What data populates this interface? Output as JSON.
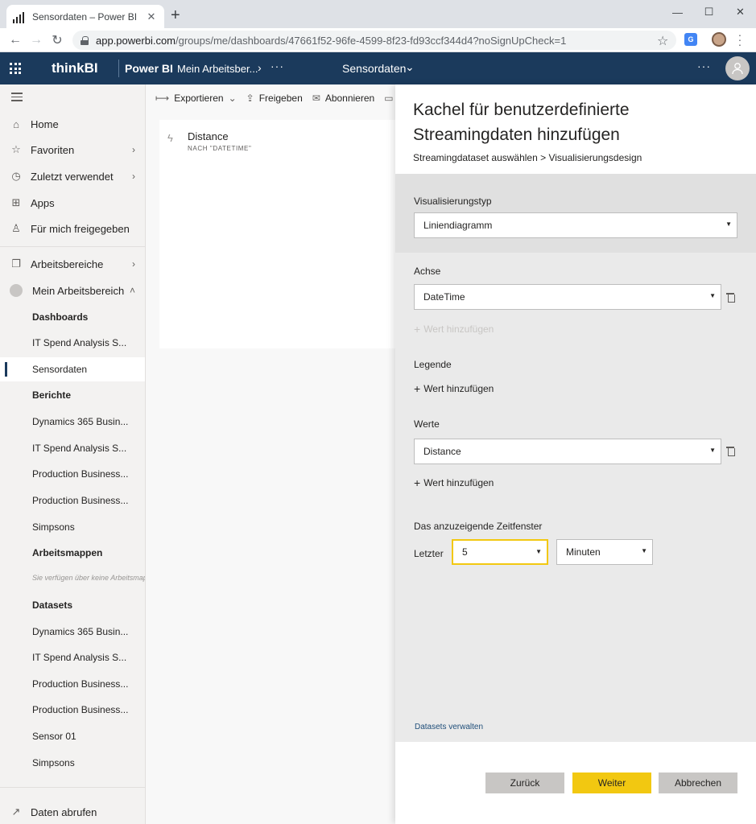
{
  "browser": {
    "tab_title": "Sensordaten – Power BI",
    "tab_close": "✕",
    "new_tab": "+",
    "url_host": "app.powerbi.com",
    "url_path": "/groups/me/dashboards/47661f52-96fe-4599-8f23-fd93ccf344d4?noSignUpCheck=1",
    "window_controls": [
      "—",
      "☐",
      "✕"
    ],
    "ext_label": "G"
  },
  "header": {
    "brand": "thinkBI",
    "product": "Power BI",
    "workspace": "Mein Arbeitsber...",
    "dashboard": "Sensordaten",
    "header_bg": "#1b3a5c"
  },
  "nav": {
    "items": [
      {
        "label": "Home",
        "icon": "home-icon"
      },
      {
        "label": "Favoriten",
        "icon": "star-icon"
      },
      {
        "label": "Zuletzt verwendet",
        "icon": "clock-icon"
      },
      {
        "label": "Apps",
        "icon": "apps-icon"
      },
      {
        "label": "Für mich freigegeben",
        "icon": "shared-icon"
      }
    ],
    "workspaces": "Arbeitsbereiche",
    "my_workspace": "Mein Arbeitsbereich",
    "sections": {
      "dashboards": "Dashboards",
      "dashboards_items": [
        "IT Spend Analysis S...",
        "Sensordaten"
      ],
      "reports": "Berichte",
      "reports_items": [
        "Dynamics 365 Busin...",
        "IT Spend Analysis S...",
        "Production Business...",
        "Production Business...",
        "Simpsons"
      ],
      "workbooks": "Arbeitsmappen",
      "workbooks_empty": "Sie verfügen über keine Arbeitsmappen",
      "datasets": "Datasets",
      "datasets_items": [
        "Dynamics 365 Busin...",
        "IT Spend Analysis S...",
        "Production Business...",
        "Production Business...",
        "Sensor 01",
        "Simpsons"
      ]
    },
    "get_data": "Daten abrufen"
  },
  "toolbar": {
    "export": "Exportieren",
    "share": "Freigeben",
    "subscribe": "Abonnieren"
  },
  "tile": {
    "title": "Distance",
    "subtitle": "NACH \"DATETIME\""
  },
  "panel": {
    "title": "Kachel für benutzerdefinierte Streamingdaten hinzufügen",
    "breadcrumb": "Streamingdataset auswählen > Visualisierungsdesign",
    "viz_type_label": "Visualisierungstyp",
    "viz_type_value": "Liniendiagramm",
    "axis_label": "Achse",
    "axis_value": "DateTime",
    "legend_label": "Legende",
    "values_label": "Werte",
    "values_value": "Distance",
    "add_value": "Wert hinzufügen",
    "window_label": "Das anzuzeigende Zeitfenster",
    "last_label": "Letzter",
    "last_count": "5",
    "last_unit": "Minuten",
    "manage_link": "Datasets verwalten",
    "back": "Zurück",
    "next": "Weiter",
    "cancel": "Abbrechen",
    "accent": "#f2c811"
  }
}
